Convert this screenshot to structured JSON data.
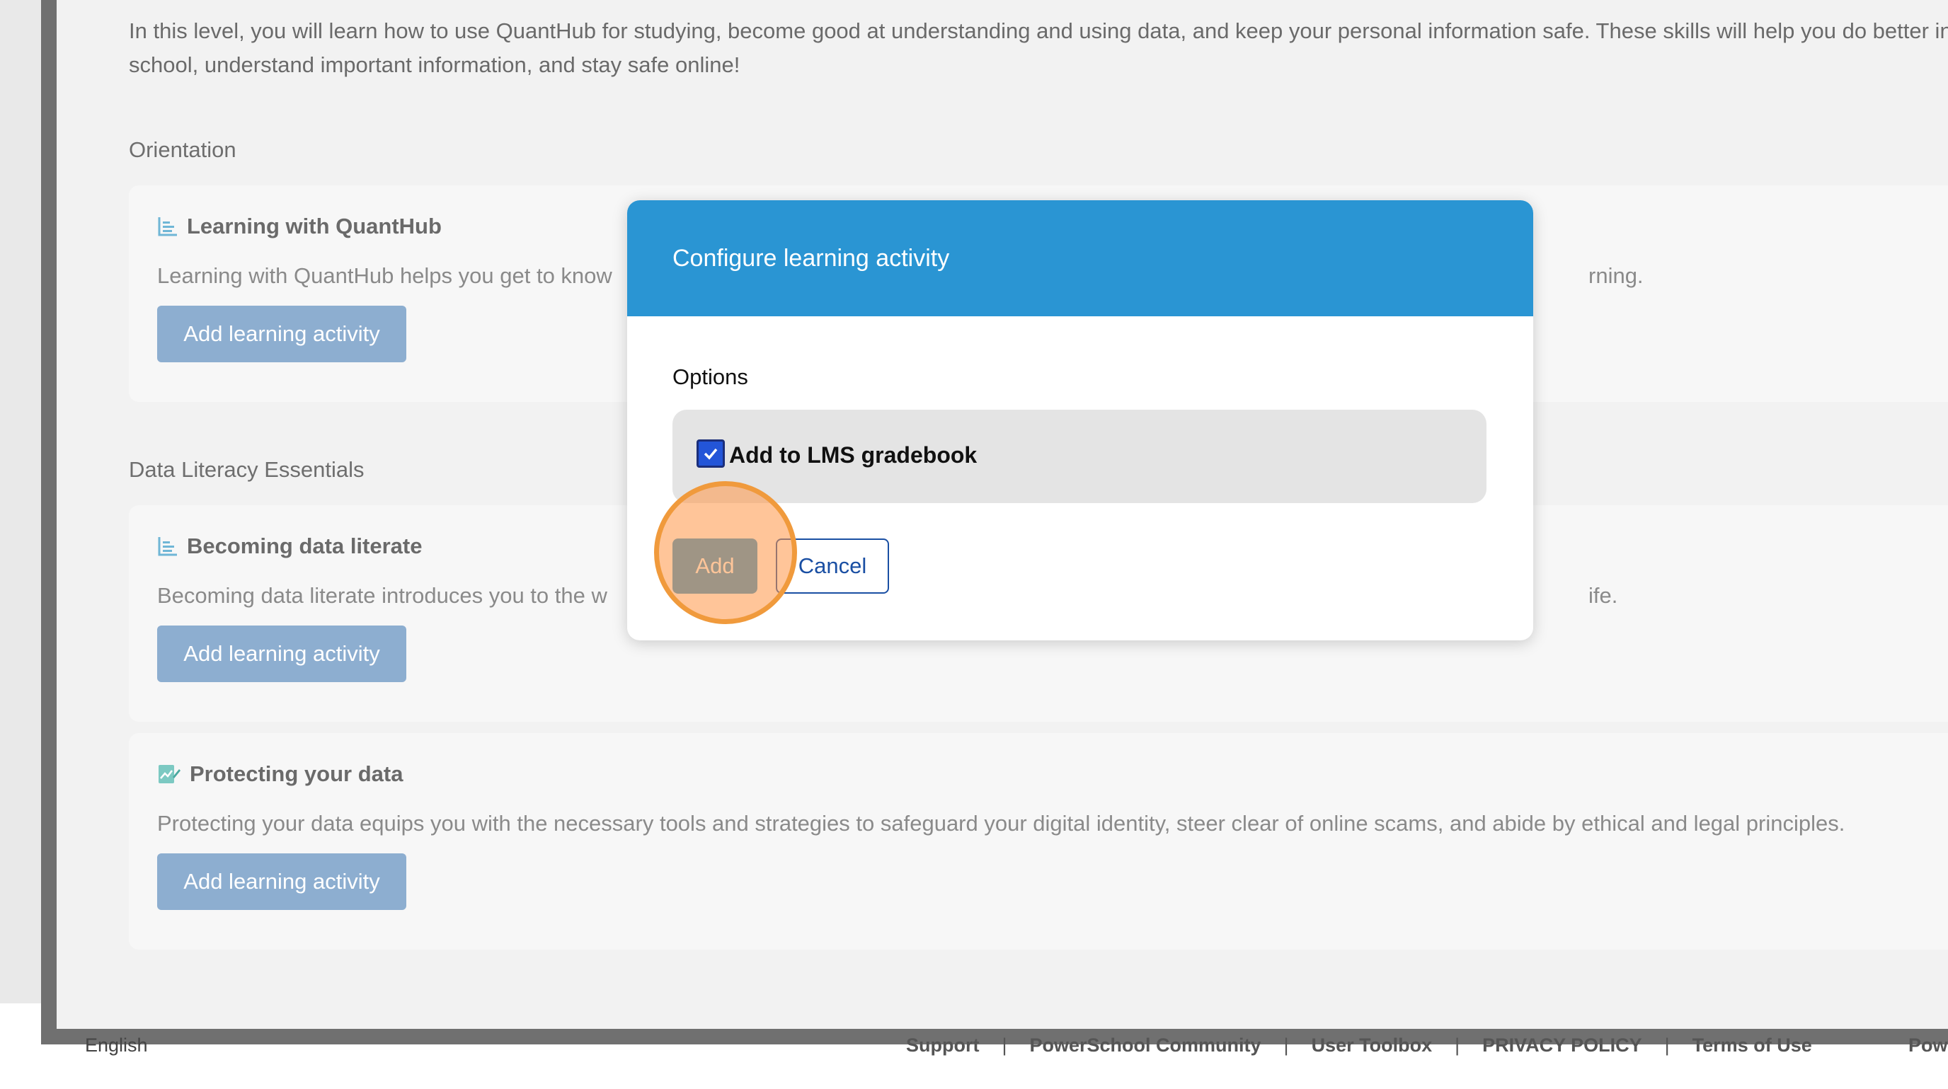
{
  "intro_text": "In this level, you will learn how to use QuantHub for studying, become good at understanding and using data, and keep your personal information safe. These skills will help you do better in school, understand important information, and stay safe online!",
  "sections": [
    {
      "heading": "Orientation"
    },
    {
      "heading": "Data Literacy Essentials"
    }
  ],
  "cards": [
    {
      "icon": "chart-icon",
      "title": "Learning with QuantHub",
      "description": "Learning with QuantHub helps you get to know",
      "description_tail": "rning.",
      "button": "Add learning activity"
    },
    {
      "icon": "chart-icon",
      "title": "Becoming data literate",
      "description": "Becoming data literate introduces you to the w",
      "description_tail": "ife.",
      "button": "Add learning activity"
    },
    {
      "icon": "edit-chart-icon",
      "title": "Protecting your data",
      "description": "Protecting your data equips you with the necessary tools and strategies to safeguard your digital identity, steer clear of online scams, and abide by ethical and legal principles.",
      "button": "Add learning activity"
    }
  ],
  "dialog": {
    "title": "Configure learning activity",
    "options_label": "Options",
    "option_label": "Add to LMS gradebook",
    "option_checked": true,
    "add_label": "Add",
    "cancel_label": "Cancel"
  },
  "footer": {
    "language": "English",
    "links": [
      "Support",
      "PowerSchool Community",
      "User Toolbox",
      "PRIVACY POLICY",
      "Terms of Use"
    ],
    "separator": "|",
    "trailing": "Pow"
  },
  "colors": {
    "accent": "#2a95d3",
    "button_muted": "#8daed0",
    "highlight": "#f09a3c"
  }
}
